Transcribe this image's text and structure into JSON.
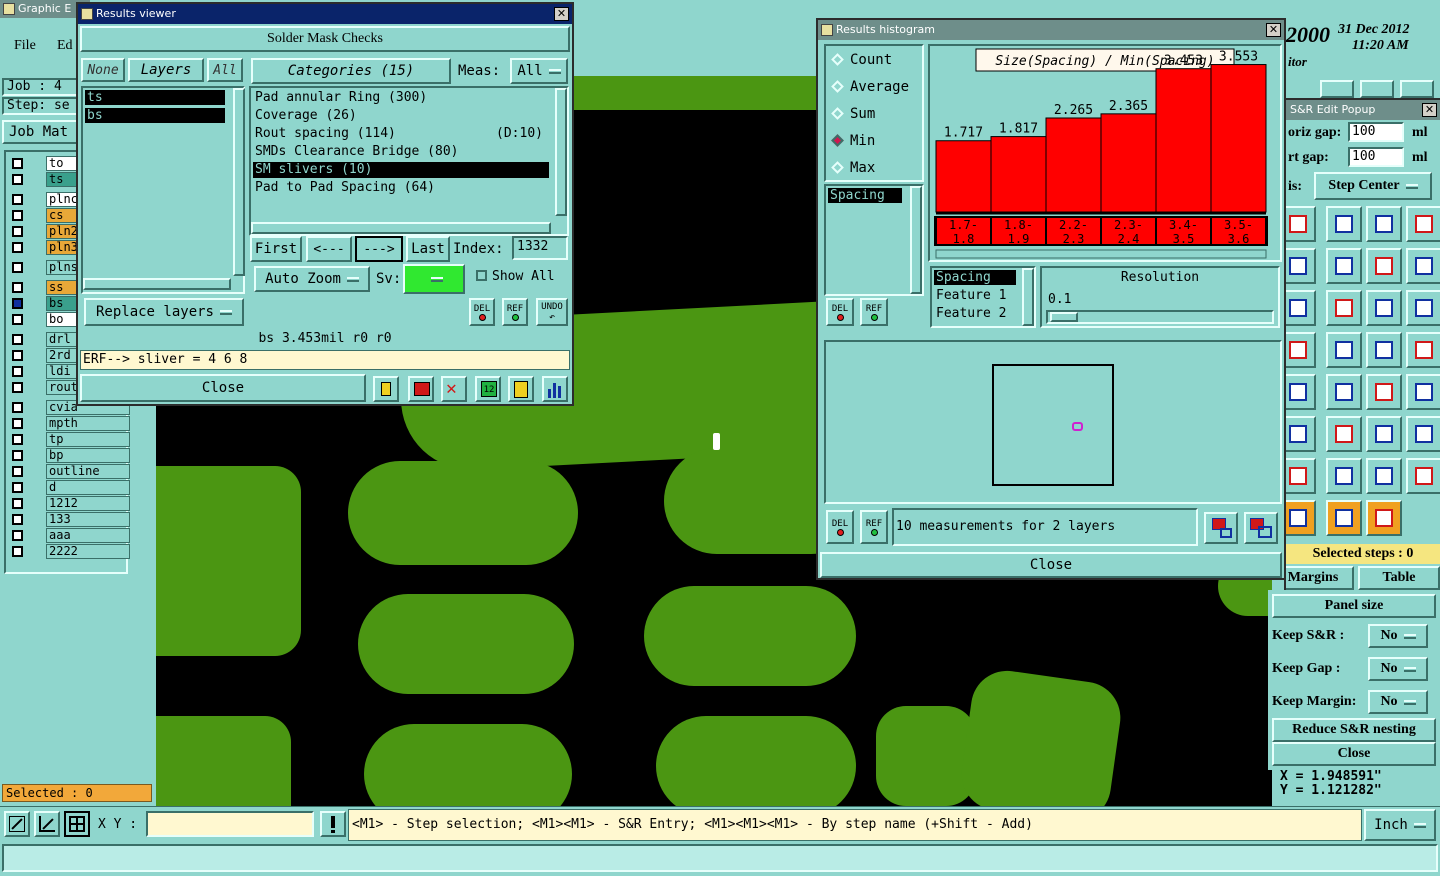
{
  "main_window": {
    "title": "Graphic E",
    "menu": [
      "File",
      "Ed"
    ],
    "job_label": "Job  :  4",
    "step_label": "Step:  se",
    "job_matrix_button": "Job Mat",
    "selected_label": "Selected : 0",
    "xy_label": "X Y :",
    "xy_value": "",
    "status_hint": "<M1> - Step selection; <M1><M1> - S&R Entry; <M1><M1><M1> - By step name (+Shift - Add)",
    "units": "Inch",
    "date_year": "2000",
    "date": "31 Dec 2012",
    "time": "11:20 AM",
    "editor_label": "itor",
    "coord_x": "X = 1.948591\"",
    "coord_y": "Y = 1.121282\""
  },
  "layers": [
    {
      "name": "to",
      "color": "#ffffff"
    },
    {
      "name": "ts",
      "color": "#3aa08c"
    },
    {
      "name": "plnc",
      "color": "#ffffff"
    },
    {
      "name": "cs",
      "color": "#e8a838"
    },
    {
      "name": "pln2",
      "color": "#e8a838"
    },
    {
      "name": "pln3",
      "color": "#e8a838"
    },
    {
      "name": "plns",
      "color": "#8fd6cd"
    },
    {
      "name": "ss",
      "color": "#e8a838"
    },
    {
      "name": "bs",
      "color": "#3aa08c"
    },
    {
      "name": "bo",
      "color": "#ffffff"
    },
    {
      "name": "drl",
      "color": "#8fd6cd"
    },
    {
      "name": "2rd",
      "color": "#8fd6cd"
    },
    {
      "name": "ldi",
      "color": "#8fd6cd"
    },
    {
      "name": "rout",
      "color": "#8fd6cd"
    },
    {
      "name": "cvia",
      "color": "#8fd6cd"
    },
    {
      "name": "mpth",
      "color": "#8fd6cd"
    },
    {
      "name": "tp",
      "color": "#8fd6cd"
    },
    {
      "name": "bp",
      "color": "#8fd6cd"
    },
    {
      "name": "outline",
      "color": "#8fd6cd"
    },
    {
      "name": "d",
      "color": "#8fd6cd"
    },
    {
      "name": "1212",
      "color": "#8fd6cd"
    },
    {
      "name": "133",
      "color": "#8fd6cd"
    },
    {
      "name": "aaa",
      "color": "#8fd6cd"
    },
    {
      "name": "2222",
      "color": "#8fd6cd"
    }
  ],
  "results_viewer": {
    "title": "Results viewer",
    "header": "Solder Mask Checks",
    "none_btn": "None",
    "layers_btn": "Layers",
    "all_btn": "All",
    "categories_btn": "Categories (15)",
    "meas_label": "Meas:",
    "meas_value": "All",
    "layer_list": [
      "ts",
      "bs"
    ],
    "categories": [
      {
        "text": "Pad annular Ring (300)",
        "extra": "",
        "selected": false
      },
      {
        "text": "Coverage (26)",
        "extra": "",
        "selected": false
      },
      {
        "text": "Rout spacing (114)",
        "extra": "(D:10)",
        "selected": false
      },
      {
        "text": "SMDs Clearance Bridge (80)",
        "extra": "",
        "selected": false
      },
      {
        "text": "SM slivers (10)",
        "extra": "",
        "selected": true
      },
      {
        "text": "Pad to Pad Spacing (64)",
        "extra": "",
        "selected": false
      }
    ],
    "replace_layers": "Replace layers",
    "first_btn": "First",
    "prev_btn": "<---",
    "next_btn": "--->",
    "last_btn": "Last",
    "index_label": "Index:",
    "index_value": "1332",
    "auto_zoom": "Auto Zoom",
    "sv_label": "Sv:",
    "show_all": "Show All",
    "del_btn": "DEL",
    "ref_btn": "REF",
    "undo_btn": "UNDO",
    "info_line": "bs 3.453mil  r0  r0",
    "erf_line": "ERF--> sliver = 4 6 8",
    "close_btn": "Close"
  },
  "histogram": {
    "title": "Results histogram",
    "modes": [
      {
        "label": "Count",
        "selected": false
      },
      {
        "label": "Average",
        "selected": false
      },
      {
        "label": "Sum",
        "selected": false
      },
      {
        "label": "Min",
        "selected": true
      },
      {
        "label": "Max",
        "selected": false
      }
    ],
    "spacing_list": [
      "Spacing"
    ],
    "chart_title": "Size(Spacing) / Min(Spacing)",
    "feature_list": [
      "Spacing",
      "Feature 1",
      "Feature 2"
    ],
    "resolution_label": "Resolution",
    "resolution_value": "0.1",
    "del_btn": "DEL",
    "ref_btn": "REF",
    "summary": "10 measurements for 2 layers",
    "close_btn": "Close"
  },
  "chart_data": {
    "type": "bar",
    "title": "Size(Spacing) / Min(Spacing)",
    "categories": [
      "1.7-1.8",
      "1.8-1.9",
      "2.2-2.3",
      "2.3-2.4",
      "3.4-3.5",
      "3.5-3.6"
    ],
    "tick_labels": [
      [
        "1.7-",
        "1.8"
      ],
      [
        "1.8-",
        "1.9"
      ],
      [
        "2.2-",
        "2.3"
      ],
      [
        "2.3-",
        "2.4"
      ],
      [
        "3.4-",
        "3.5"
      ],
      [
        "3.5-",
        "3.6"
      ]
    ],
    "values": [
      1.717,
      1.817,
      2.265,
      2.365,
      3.453,
      3.553
    ],
    "value_labels": [
      "1.717",
      "1.817",
      "2.265",
      "2.365",
      "3.453",
      "3.553"
    ],
    "ylim": [
      0,
      4.0
    ],
    "bar_color": "#ff0000",
    "grid": false
  },
  "sr_popup": {
    "title": "S&R Edit Popup",
    "horiz_gap_label": "oriz gap:",
    "horiz_gap_value": "100",
    "vert_gap_label": "rt  gap:",
    "vert_gap_value": "100",
    "unit": "ml",
    "axis_label": "is:",
    "axis_value": "Step Center",
    "selected_steps": "Selected steps : 0",
    "margins_btn": "Margins",
    "table_btn": "Table",
    "panel_size_btn": "Panel size",
    "keep_sr_label": "Keep S&R   :",
    "keep_sr_value": "No",
    "keep_gap_label": "Keep Gap    :",
    "keep_gap_value": "No",
    "keep_margin_label": "Keep Margin:",
    "keep_margin_value": "No",
    "reduce_btn": "Reduce S&R nesting",
    "close_btn": "Close"
  },
  "colors": {
    "panel": "#8fd6cd",
    "copper": "#4b9612",
    "canvas": "#000000",
    "highlight": "#f5e6a0",
    "bar": "#ff0000"
  }
}
